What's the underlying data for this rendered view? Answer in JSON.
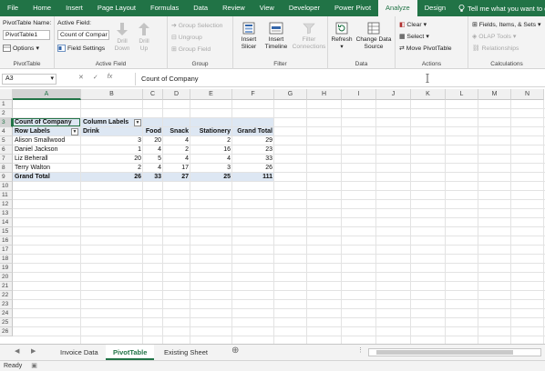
{
  "ribbon_tabs": [
    {
      "label": "File",
      "active": false
    },
    {
      "label": "Home",
      "active": false
    },
    {
      "label": "Insert",
      "active": false
    },
    {
      "label": "Page Layout",
      "active": false
    },
    {
      "label": "Formulas",
      "active": false
    },
    {
      "label": "Data",
      "active": false
    },
    {
      "label": "Review",
      "active": false
    },
    {
      "label": "View",
      "active": false
    },
    {
      "label": "Developer",
      "active": false
    },
    {
      "label": "Power Pivot",
      "active": false
    },
    {
      "label": "Analyze",
      "active": true
    },
    {
      "label": "Design",
      "active": false
    }
  ],
  "tell_me": "Tell me what you want to do",
  "groups": {
    "pivottable": {
      "label": "PivotTable",
      "name_label": "PivotTable Name:",
      "name_value": "PivotTable1",
      "options": "Options"
    },
    "active_field": {
      "label": "Active Field",
      "field_label": "Active Field:",
      "field_value": "Count of Compar",
      "field_settings": "Field Settings",
      "drill_down": [
        "Drill",
        "Down"
      ],
      "drill_up": [
        "Drill",
        "Up"
      ]
    },
    "group": {
      "label": "Group",
      "group_selection": "Group Selection",
      "ungroup": "Ungroup",
      "group_field": "Group Field"
    },
    "filter": {
      "label": "Filter",
      "insert_slicer": [
        "Insert",
        "Slicer"
      ],
      "insert_timeline": [
        "Insert",
        "Timeline"
      ],
      "filter_connections": [
        "Filter",
        "Connections"
      ]
    },
    "data": {
      "label": "Data",
      "refresh": "Refresh",
      "change_data_source": [
        "Change Data",
        "Source"
      ]
    },
    "actions": {
      "label": "Actions",
      "clear": "Clear",
      "select": "Select",
      "move_pivottable": "Move PivotTable"
    },
    "calculations": {
      "label": "Calculations",
      "fields_items_sets": "Fields, Items, & Sets",
      "olap_tools": "OLAP Tools",
      "relationships": "Relationships"
    }
  },
  "formula_bar": {
    "name_box": "A3",
    "cancel": "✕",
    "enter": "✓",
    "fx": "fx",
    "content": "Count of Company"
  },
  "columns": [
    "A",
    "B",
    "C",
    "D",
    "E",
    "F",
    "G",
    "H",
    "I",
    "J",
    "K",
    "L",
    "M",
    "N"
  ],
  "rows": [
    "1",
    "2",
    "3",
    "4",
    "5",
    "6",
    "7",
    "8",
    "9",
    "10",
    "11",
    "12",
    "13",
    "14",
    "15",
    "16",
    "17",
    "18",
    "19",
    "20",
    "21",
    "22",
    "23",
    "24",
    "25",
    "26"
  ],
  "pivot": {
    "corner": "Count of Company",
    "column_labels": "Column Labels",
    "row_labels": "Row Labels",
    "headers": [
      "Drink",
      "Food",
      "Snack",
      "Stationery",
      "Grand Total"
    ],
    "rows": [
      {
        "name": "Alison Smallwood",
        "values": [
          "3",
          "20",
          "4",
          "2",
          "29"
        ]
      },
      {
        "name": "Daniel Jackson",
        "values": [
          "1",
          "4",
          "2",
          "16",
          "23"
        ]
      },
      {
        "name": "Liz Beherall",
        "values": [
          "20",
          "5",
          "4",
          "4",
          "33"
        ]
      },
      {
        "name": "Terry Walton",
        "values": [
          "2",
          "4",
          "17",
          "3",
          "26"
        ]
      }
    ],
    "total": {
      "name": "Grand Total",
      "values": [
        "26",
        "33",
        "27",
        "25",
        "111"
      ]
    }
  },
  "sheets": [
    {
      "label": "Invoice Data",
      "active": false
    },
    {
      "label": "PivotTable",
      "active": true
    },
    {
      "label": "Existing Sheet",
      "active": false
    }
  ],
  "status": "Ready",
  "colors": {
    "accent": "#217346",
    "pivot_header": "#dde7f3"
  }
}
